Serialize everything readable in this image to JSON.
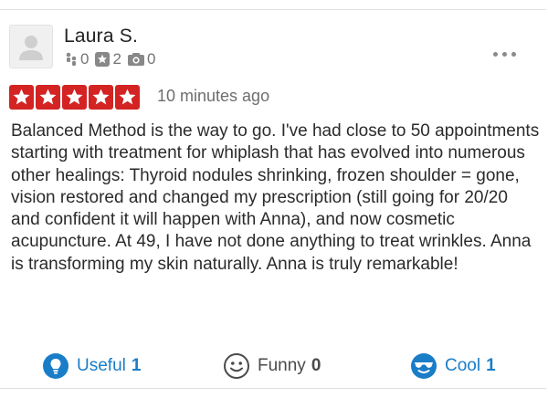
{
  "review": {
    "user": {
      "name": "Laura S.",
      "friends_count": "0",
      "reviews_count": "2",
      "photos_count": "0"
    },
    "rating": 5,
    "time_ago": "10 minutes ago",
    "text": "Balanced Method is the way to go.  I've had close to 50 appointments starting with treatment for whiplash that has evolved into numerous other healings: Thyroid nodules shrinking, frozen shoulder = gone, vision restored and changed my prescription (still going for 20/20 and confident it will happen with Anna), and now cosmetic acupuncture. At 49, I have not done anything to treat wrinkles. Anna is transforming my skin naturally. Anna is truly remarkable!",
    "reactions": {
      "useful": {
        "label": "Useful",
        "count": "1"
      },
      "funny": {
        "label": "Funny",
        "count": "0"
      },
      "cool": {
        "label": "Cool",
        "count": "1"
      }
    }
  },
  "colors": {
    "star_red": "#d32323",
    "action_blue": "#1a7dc7",
    "muted_gray": "#757575"
  },
  "icons": [
    "avatar-placeholder-icon",
    "friends-icon",
    "review-star-icon",
    "camera-icon",
    "more-icon",
    "lightbulb-icon",
    "smiley-icon",
    "sunglasses-icon"
  ]
}
